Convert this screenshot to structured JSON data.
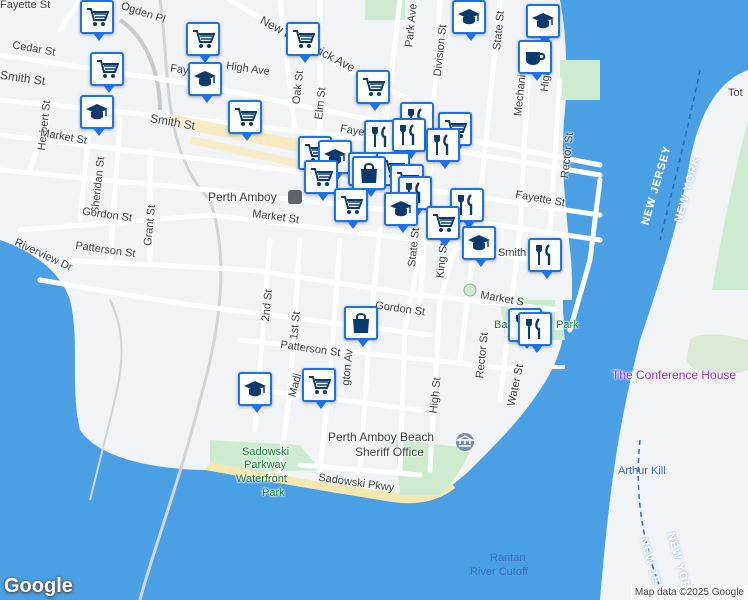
{
  "map": {
    "streets": {
      "fayette_st_nw": "Fayette St",
      "ogden_pl": "Ogden Pl",
      "cedar_st": "Cedar St",
      "smith_st_nw": "Smith St",
      "new_brunswick_ave": "New Brunswick Ave",
      "high_ave": "High Ave",
      "fayette_st_mid": "Fayette",
      "oak_st": "Oak St",
      "elm_st": "Elm St",
      "park_ave": "Park Ave",
      "division_st": "Division St",
      "state_st_n": "State St",
      "mechanic": "Mechani",
      "high_st_ne": "High",
      "tot": "Tot",
      "herbert_st": "Herbert St",
      "market_st_w": "Market St",
      "smith_st_mid": "Smith St",
      "fayette_st_mid2": "Fayet",
      "rector_st_n": "Rector St",
      "sheridan_st": "Sheridan St",
      "gordon_st_w": "Gordon St",
      "grant_st": "Grant St",
      "patterson_st_w": "Patterson St",
      "riverview_dr": "Riverview Dr",
      "market_st_mid": "Market St",
      "fayette_st_e": "Fayette St",
      "smith_e": "Smith",
      "state_st_s": "State St",
      "king_st": "King St",
      "second_st": "2nd St",
      "first_st": "1st St",
      "gordon_st_e": "Gordon St",
      "market_st_e": "Market S",
      "patterson_st_e": "Patterson St",
      "washington_ave": "gton Av",
      "madison": "Madi",
      "high_st_s": "High St",
      "rector_st_s": "Rector St",
      "water_st": "Water St",
      "sadowski_pkwy": "Sadowski Pkwy"
    },
    "places": {
      "perth_amboy": "Perth Amboy",
      "beach_line1": "Perth Amboy Beach",
      "beach_line2": "Sheriff Office",
      "park_line1": "Sadowski",
      "park_line2": "Parkway",
      "park_line3": "Waterfront",
      "park_line4": "Park",
      "park_e": "Park",
      "park_e_prefix": "Ba",
      "conference_house": "The Conference House",
      "arthur_kill": "Arthur Kill",
      "raritan_line1": "Raritan",
      "raritan_line2": "River Cutoff",
      "new_jersey_upper": "NEW JERSEY",
      "new_york_upper": "NEW YORK",
      "new_jersey_lower": "NEW JER",
      "new_york_lower": "NEW YORK"
    },
    "logo": "Google",
    "attribution": "Map data ©2025 Google",
    "colors": {
      "water": "#4b9fe3",
      "land": "#f1f3f4",
      "park": "#cdeccf",
      "pin_border": "#1a73e8",
      "pin_icon": "#0b3a6f"
    }
  }
}
